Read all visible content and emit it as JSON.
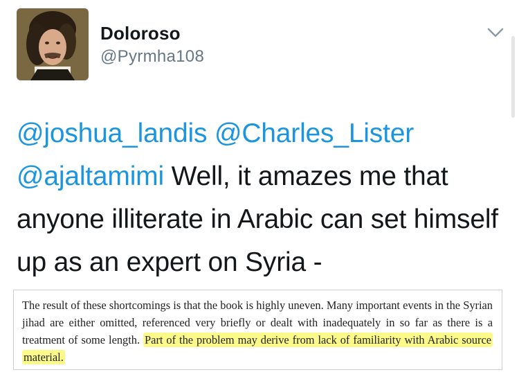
{
  "user": {
    "display_name": "Doloroso",
    "handle": "@Pyrmha108",
    "avatar_icon": "portrait-avatar"
  },
  "menu": {
    "icon": "chevron-down-icon"
  },
  "tweet": {
    "mentions": [
      "@joshua_landis",
      "@Charles_Lister",
      "@ajaltamimi"
    ],
    "body": "Well, it amazes me that anyone illiterate in Arabic can set himself up as an expert on Syria -"
  },
  "excerpt": {
    "text_plain": "The result of these shortcomings is that the book is highly uneven. Many important events in the Syrian jihad are either omitted, referenced very briefly or dealt with inadequately in so far as there is a treatment of some length.",
    "text_highlighted": "Part of the problem may derive from lack of familiarity with Arabic source material.",
    "highlight_color": "#fbf98a"
  },
  "colors": {
    "mention": "#1b95e0",
    "handle": "#657786",
    "text": "#14171a"
  }
}
